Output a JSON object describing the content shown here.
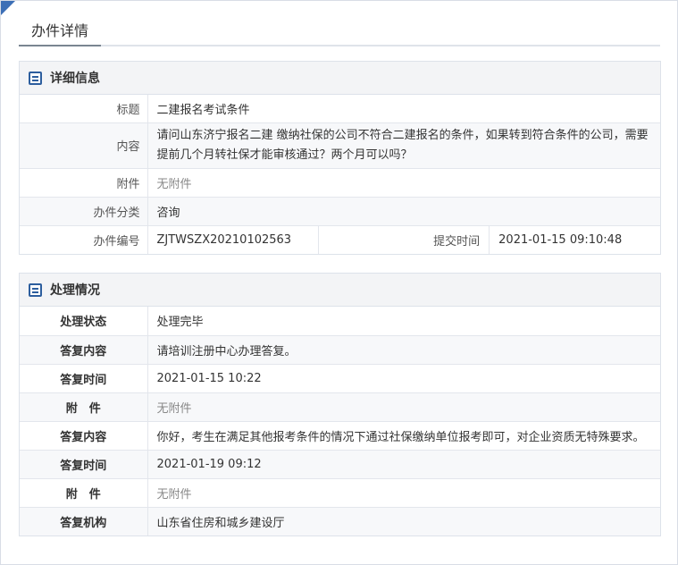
{
  "page": {
    "title": "办件详情"
  },
  "detail": {
    "section_title": "详细信息",
    "rows": {
      "subject_label": "标题",
      "subject_value": "二建报名考试条件",
      "content_label": "内容",
      "content_value": "请问山东济宁报名二建 缴纳社保的公司不符合二建报名的条件，如果转到符合条件的公司，需要提前几个月转社保才能审核通过？两个月可以吗？",
      "attachment_label": "附件",
      "attachment_value": "无附件",
      "category_label": "办件分类",
      "category_value": "咨询",
      "number_label": "办件编号",
      "number_value": "ZJTWSZX20210102563",
      "submit_time_label": "提交时间",
      "submit_time_value": "2021-01-15 09:10:48"
    }
  },
  "processing": {
    "section_title": "处理情况",
    "rows": [
      {
        "label": "处理状态",
        "value": "处理完毕",
        "muted": false
      },
      {
        "label": "答复内容",
        "value": "请培训注册中心办理答复。",
        "muted": false
      },
      {
        "label": "答复时间",
        "value": "2021-01-15 10:22",
        "muted": false
      },
      {
        "label": "附　件",
        "value": "无附件",
        "muted": true
      },
      {
        "label": "答复内容",
        "value": "你好，考生在满足其他报考条件的情况下通过社保缴纳单位报考即可，对企业资质无特殊要求。",
        "muted": false
      },
      {
        "label": "答复时间",
        "value": "2021-01-19 09:12",
        "muted": false
      },
      {
        "label": "附　件",
        "value": "无附件",
        "muted": true
      },
      {
        "label": "答复机构",
        "value": "山东省住房和城乡建设厅",
        "muted": false
      }
    ]
  },
  "colors": {
    "accent": "#3d6fb6",
    "icon": "#2d5e9e",
    "header_bg": "#f3f4f6"
  },
  "icons": {
    "corner": "corner-triangle-icon",
    "section": "document-list-icon"
  }
}
